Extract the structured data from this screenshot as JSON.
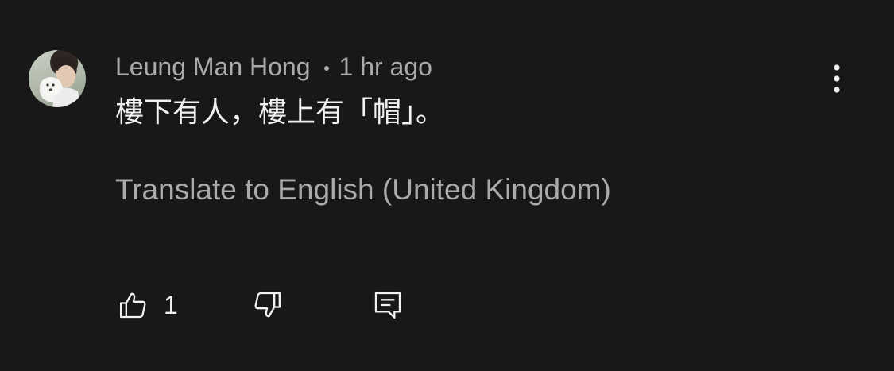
{
  "comment": {
    "author": "Leung Man Hong",
    "separator": "•",
    "time": "1 hr ago",
    "text": "樓下有人，樓上有「帽」。",
    "translate_label": "Translate to English (United Kingdom)",
    "like_count": "1"
  },
  "icons": {
    "menu": "more-vert-icon",
    "like": "thumb-up-icon",
    "dislike": "thumb-down-icon",
    "reply": "reply-comment-icon"
  },
  "colors": {
    "background": "#181818",
    "primary_text": "#f1f1f1",
    "secondary_text": "#aaaaaa"
  }
}
